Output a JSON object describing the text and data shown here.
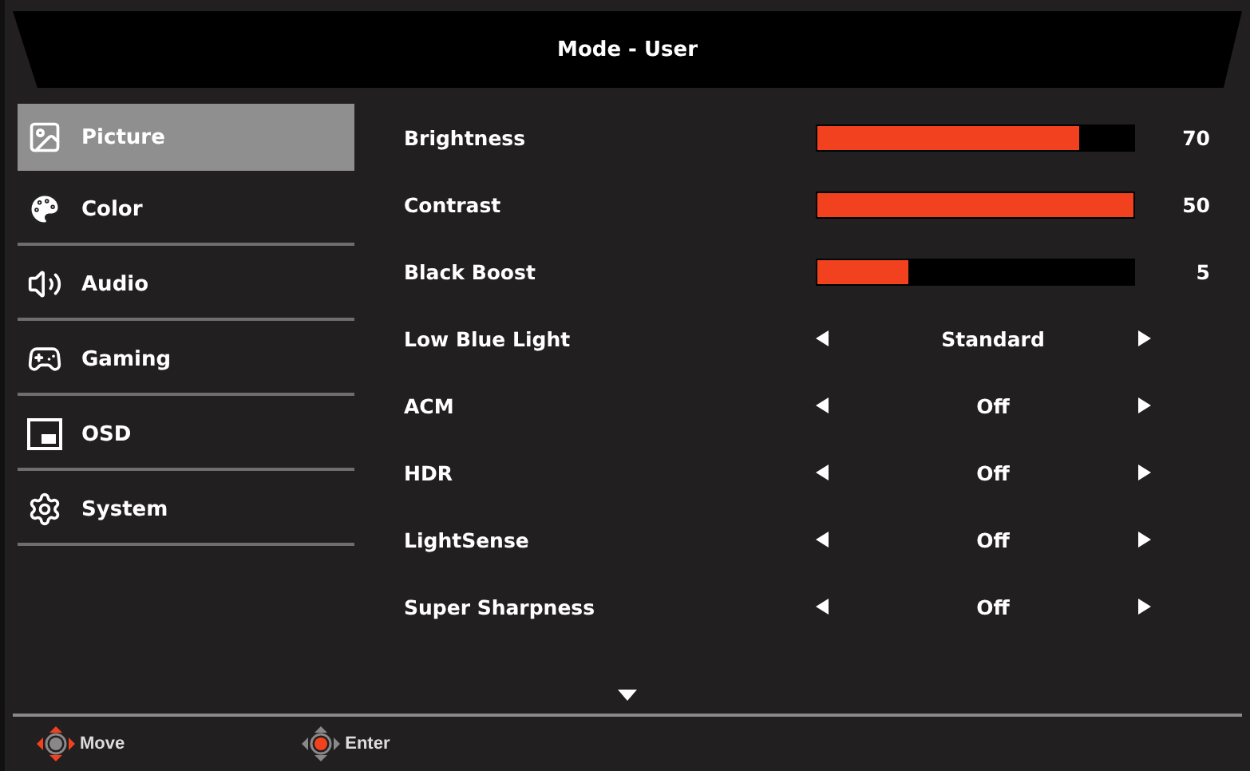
{
  "header": {
    "title": "Mode - User"
  },
  "sidebar": {
    "items": [
      {
        "label": "Picture",
        "kind": "picture",
        "selected": true
      },
      {
        "label": "Color",
        "kind": "color",
        "selected": false
      },
      {
        "label": "Audio",
        "kind": "audio",
        "selected": false
      },
      {
        "label": "Gaming",
        "kind": "gaming",
        "selected": false
      },
      {
        "label": "OSD",
        "kind": "osd",
        "selected": false
      },
      {
        "label": "System",
        "kind": "system",
        "selected": false
      }
    ]
  },
  "settings": [
    {
      "kind": "slider",
      "label": "Brightness",
      "level": 0.83,
      "reading": "70"
    },
    {
      "kind": "slider",
      "label": "Contrast",
      "level": 1.0,
      "reading": "50"
    },
    {
      "kind": "slider",
      "label": "Black Boost",
      "level": 0.29,
      "reading": "5"
    },
    {
      "kind": "option",
      "label": "Low Blue Light",
      "value": "Standard"
    },
    {
      "kind": "option",
      "label": "ACM",
      "value": "Off"
    },
    {
      "kind": "option",
      "label": "HDR",
      "value": "Off"
    },
    {
      "kind": "option",
      "label": "LightSense",
      "value": "Off"
    },
    {
      "kind": "option",
      "label": "Super Sharpness",
      "value": "Off"
    }
  ],
  "footer": {
    "hints": [
      {
        "kind": "move",
        "label": "Move"
      },
      {
        "kind": "enter",
        "label": "Enter"
      }
    ]
  }
}
